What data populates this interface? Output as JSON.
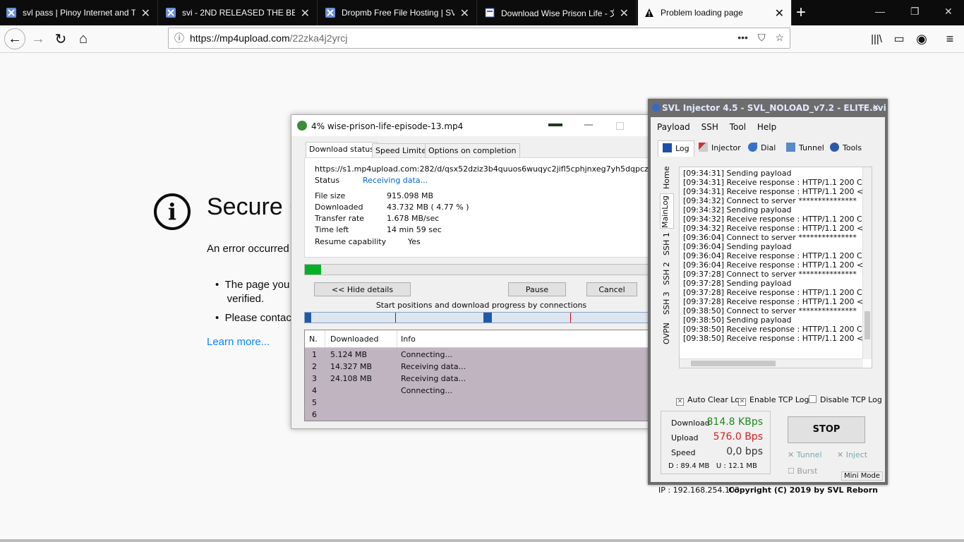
{
  "browser": {
    "tabs": [
      {
        "title": "svl pass | Pinoy Internet and Tec",
        "icon": "svl-favicon"
      },
      {
        "title": "svi - 2ND RELEASED THE BEST S",
        "icon": "svl-favicon"
      },
      {
        "title": "Dropmb Free File Hosting | SVL",
        "icon": "svl-favicon"
      },
      {
        "title": "Download Wise Prison Life - 文",
        "icon": "page-favicon"
      },
      {
        "title": "Problem loading page",
        "icon": "warning-icon"
      }
    ],
    "url_host": "https://mp4upload.com",
    "url_path": "/22zka4j2yrcj"
  },
  "error_page": {
    "title": "Secure C",
    "description": "An error occurred",
    "bullets": [
      "The page you",
      "verified.",
      "Please contac"
    ],
    "learn_more": "Learn more..."
  },
  "download": {
    "title": "4% wise-prison-life-episode-13.mp4",
    "tabs": [
      "Download status",
      "Speed Limiter",
      "Options on completion"
    ],
    "url": "https://s1.mp4upload.com:282/d/qsx52dziz3b4quuos6wuqyc2jifl5cphjnxeg7yh5dqpczxm3romjthq/",
    "status_label": "Status",
    "status_value": "Receiving data...",
    "file_size_label": "File size",
    "file_size": "915.098  MB",
    "downloaded_label": "Downloaded",
    "downloaded": "43.732  MB  ( 4.77 % )",
    "rate_label": "Transfer rate",
    "rate": "1.678  MB/sec",
    "time_left_label": "Time left",
    "time_left": "14 min 59 sec",
    "resume_label": "Resume capability",
    "resume": "Yes",
    "progress_fraction": 0.0477,
    "hide_details": "<< Hide details",
    "pause": "Pause",
    "cancel": "Cancel",
    "connections_label": "Start positions and download progress by connections",
    "table_headers": [
      "N.",
      "Downloaded",
      "Info"
    ],
    "rows": [
      {
        "n": "1",
        "downloaded": "5.124  MB",
        "info": "Connecting..."
      },
      {
        "n": "2",
        "downloaded": "14.327  MB",
        "info": "Receiving data..."
      },
      {
        "n": "3",
        "downloaded": "24.108  MB",
        "info": "Receiving data..."
      },
      {
        "n": "4",
        "downloaded": "",
        "info": "Connecting..."
      },
      {
        "n": "5",
        "downloaded": "",
        "info": ""
      },
      {
        "n": "6",
        "downloaded": "",
        "info": ""
      }
    ]
  },
  "svl": {
    "title": "SVL Injector 4.5 - SVL_NOLOAD_v7.2 - ELITE.svi",
    "menu": [
      "Payload",
      "SSH",
      "Tool",
      "Help"
    ],
    "tabs": [
      "Log",
      "Injector",
      "Dial",
      "Tunnel",
      "Tools"
    ],
    "side_tabs": [
      "Home",
      "MainLog",
      "SSH 1",
      "SSH 2",
      "SSH 3",
      "OVPN"
    ],
    "log": [
      "[09:34:31] Sending payload",
      "[09:34:31] Receive response : HTTP/1.1 200 Conn",
      "[09:34:31] Receive response : HTTP/1.1 200 <fon",
      "[09:34:32] Connect to server ***************",
      "[09:34:32] Sending payload",
      "[09:34:32] Receive response : HTTP/1.1 200 Conn",
      "[09:34:32] Receive response : HTTP/1.1 200 <fon",
      "[09:36:04] Connect to server ***************",
      "[09:36:04] Sending payload",
      "[09:36:04] Receive response : HTTP/1.1 200 Conn",
      "[09:36:04] Receive response : HTTP/1.1 200 <fon",
      "[09:37:28] Connect to server ***************",
      "[09:37:28] Sending payload",
      "[09:37:28] Receive response : HTTP/1.1 200 Conn",
      "[09:37:28] Receive response : HTTP/1.1 200 <fon",
      "[09:38:50] Connect to server ***************",
      "[09:38:50] Sending payload",
      "[09:38:50] Receive response : HTTP/1.1 200 Conn",
      "[09:38:50] Receive response : HTTP/1.1 200 <fon"
    ],
    "auto_clear": "Auto Clear Log",
    "enable_tcp": "Enable TCP Log",
    "disable_tcp": "Disable TCP Log",
    "download_label": "Download",
    "download_value": "814.8 KBps",
    "upload_label": "Upload",
    "upload_value": "576.0 Bps",
    "speed_label": "Speed",
    "speed_value": "0,0 bps",
    "d_total": "D :   89.4 MB",
    "u_total": "U :   12.1 MB",
    "stop": "STOP",
    "tunnel": "Tunnel",
    "inject": "Inject",
    "burst": "Burst",
    "mini_mode": "Mini Mode",
    "ip": "IP : 192.168.254.103",
    "copyright": "Copyright (C) 2019 by SVL Reborn"
  }
}
